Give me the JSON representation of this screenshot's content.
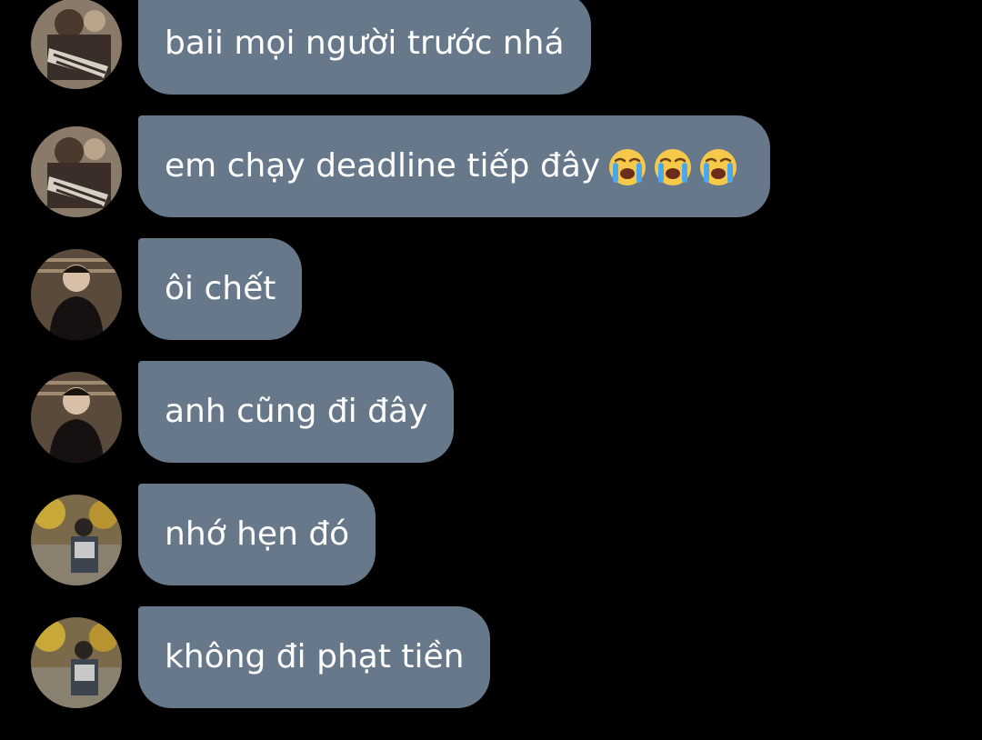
{
  "colors": {
    "background": "#000000",
    "bubble": "#66788a",
    "text": "#ffffff"
  },
  "messages": [
    {
      "avatar": "avatar-user-a",
      "text": "baii mọi người trước nhá"
    },
    {
      "avatar": "avatar-user-a",
      "text": "em chạy deadline tiếp đây",
      "emojis": [
        "loudly-crying-face-icon",
        "loudly-crying-face-icon",
        "loudly-crying-face-icon"
      ]
    },
    {
      "avatar": "avatar-user-b",
      "text": "ôi chết"
    },
    {
      "avatar": "avatar-user-b",
      "text": "anh cũng đi đây"
    },
    {
      "avatar": "avatar-user-c",
      "text": "nhớ hẹn đó"
    },
    {
      "avatar": "avatar-user-c",
      "text": "không đi phạt tiền"
    }
  ]
}
